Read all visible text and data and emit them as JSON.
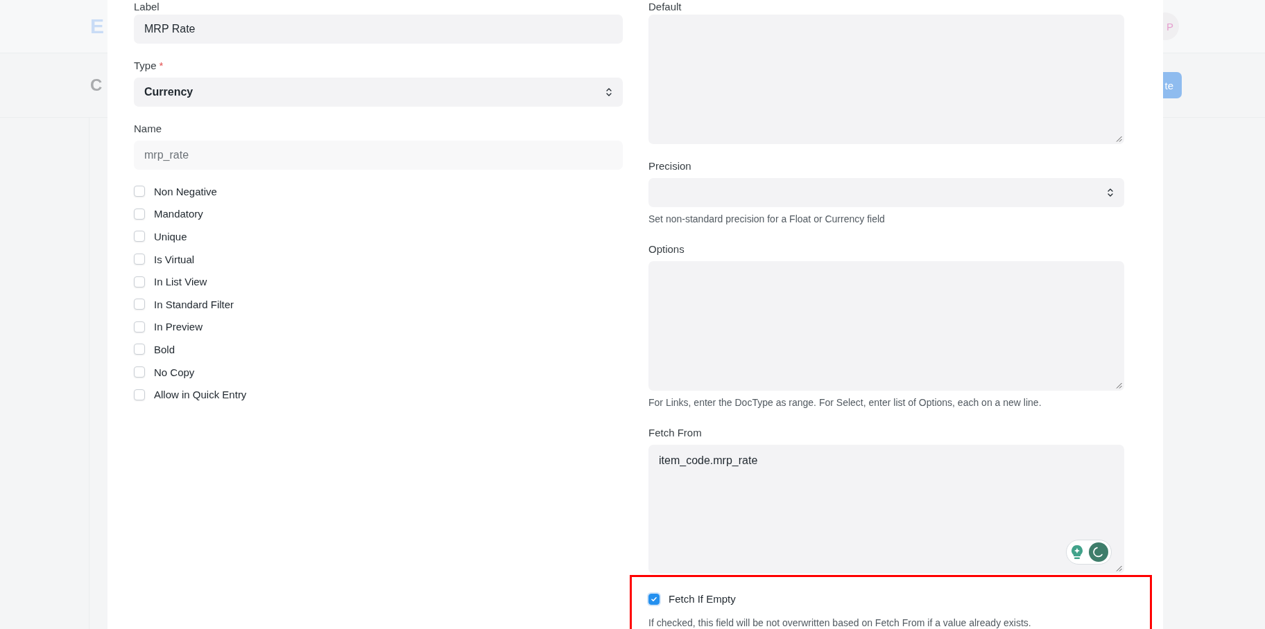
{
  "background": {
    "logo": "E",
    "page_title": "C",
    "avatar": "P",
    "primary_button": "te"
  },
  "left": {
    "label_field": {
      "label": "Label",
      "value": "MRP Rate"
    },
    "type_field": {
      "label": "Type",
      "required_mark": "*",
      "value": "Currency"
    },
    "name_field": {
      "label": "Name",
      "value": "mrp_rate",
      "read_only": true
    },
    "checkboxes": [
      {
        "label": "Non Negative",
        "checked": false
      },
      {
        "label": "Mandatory",
        "checked": false
      },
      {
        "label": "Unique",
        "checked": false
      },
      {
        "label": "Is Virtual",
        "checked": false
      },
      {
        "label": "In List View",
        "checked": false
      },
      {
        "label": "In Standard Filter",
        "checked": false
      },
      {
        "label": "In Preview",
        "checked": false
      },
      {
        "label": "Bold",
        "checked": false
      },
      {
        "label": "No Copy",
        "checked": false
      },
      {
        "label": "Allow in Quick Entry",
        "checked": false
      }
    ]
  },
  "right": {
    "default_field": {
      "label": "Default"
    },
    "precision_field": {
      "label": "Precision",
      "help": "Set non-standard precision for a Float or Currency field"
    },
    "options_field": {
      "label": "Options",
      "help": "For Links, enter the DocType as range. For Select, enter list of Options, each on a new line."
    },
    "fetch_from_field": {
      "label": "Fetch From",
      "value": "item_code.mrp_rate"
    },
    "fetch_if_empty": {
      "label": "Fetch If Empty",
      "checked": true,
      "highlighted": true,
      "help": "If checked, this field will be not overwritten based on Fetch From if a value already exists."
    }
  }
}
